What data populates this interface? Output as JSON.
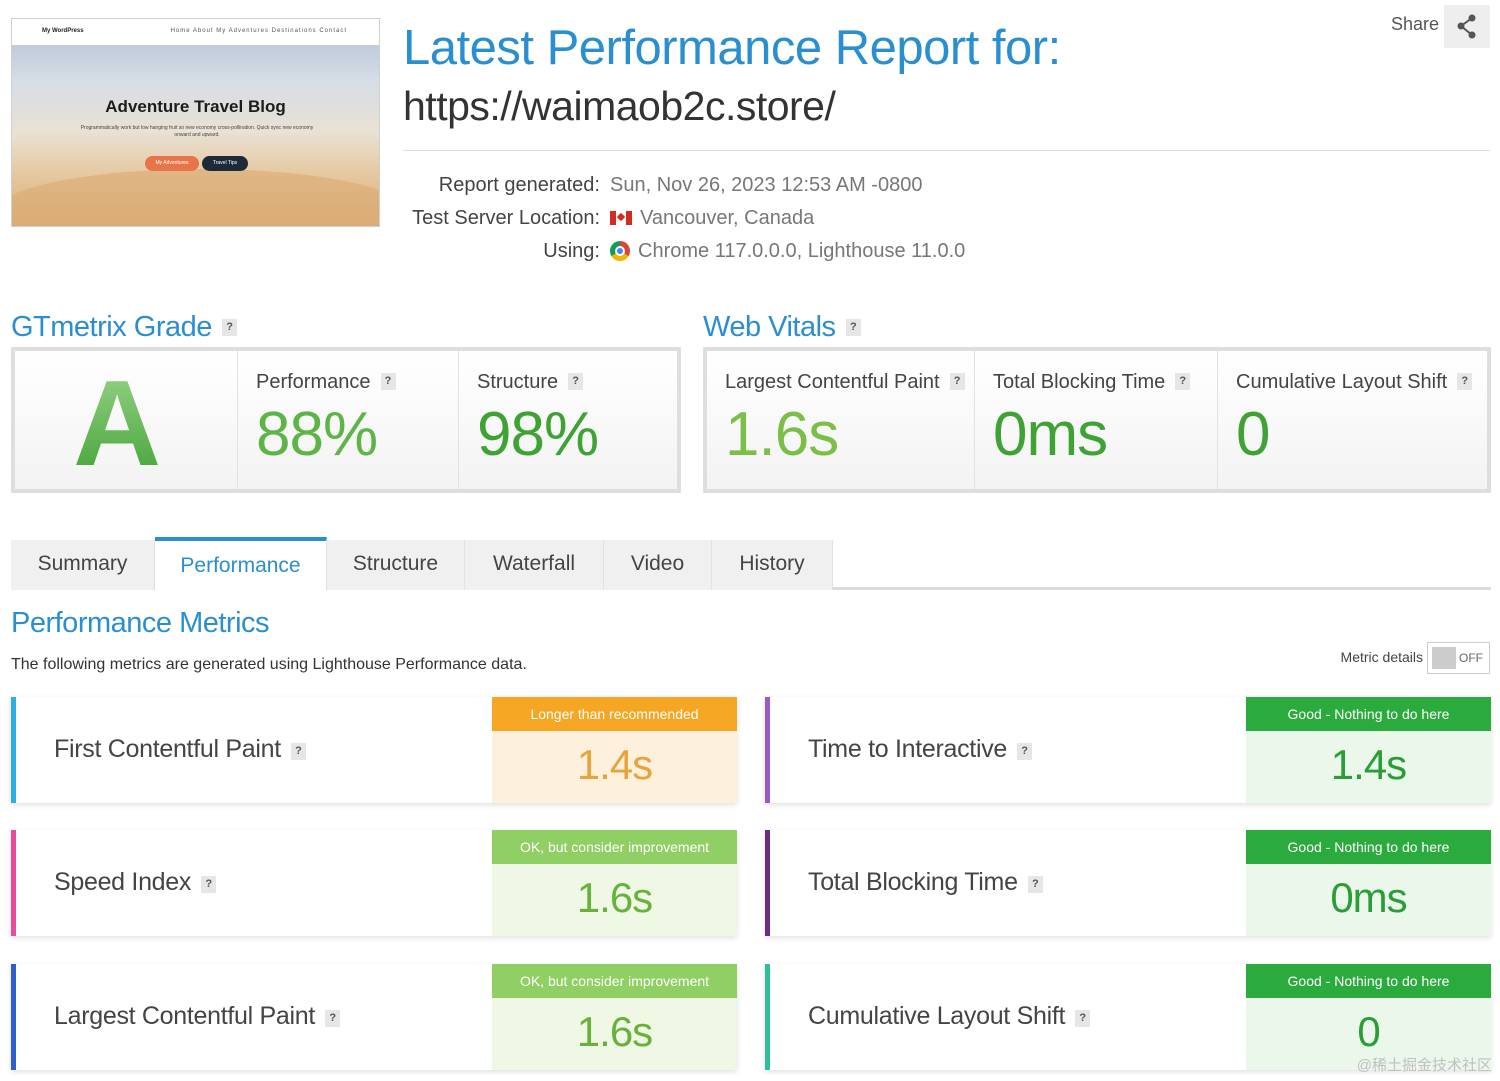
{
  "thumbnail": {
    "site_name": "My WordPress",
    "nav_links": "Home  About  My Adventures  Destinations  Contact",
    "blog_title": "Adventure Travel Blog",
    "blog_subtitle": "Programmatically work but low hanging fruit so new economy cross-pollination. Quick sync new economy onward and upward.",
    "button_primary": "My Adventures",
    "button_secondary": "Travel Tips"
  },
  "header": {
    "title": "Latest Performance Report for:",
    "url": "https://waimaob2c.store/",
    "share_label": "Share"
  },
  "meta": {
    "generated_label": "Report generated:",
    "generated_value": "Sun, Nov 26, 2023 12:53 AM -0800",
    "location_label": "Test Server Location:",
    "location_value": "Vancouver, Canada",
    "using_label": "Using:",
    "using_value": "Chrome 117.0.0.0, Lighthouse 11.0.0"
  },
  "grade": {
    "heading": "GTmetrix Grade",
    "letter": "A",
    "performance_label": "Performance",
    "performance_value": "88%",
    "structure_label": "Structure",
    "structure_value": "98%"
  },
  "vitals": {
    "heading": "Web Vitals",
    "lcp_label": "Largest Contentful Paint",
    "lcp_value": "1.6s",
    "tbt_label": "Total Blocking Time",
    "tbt_value": "0ms",
    "cls_label": "Cumulative Layout Shift",
    "cls_value": "0"
  },
  "tabs": [
    "Summary",
    "Performance",
    "Structure",
    "Waterfall",
    "Video",
    "History"
  ],
  "active_tab": "Performance",
  "metrics_section": {
    "heading": "Performance Metrics",
    "description": "The following metrics are generated using Lighthouse Performance data.",
    "details_label": "Metric details",
    "toggle_state": "OFF"
  },
  "metrics": [
    {
      "name": "First Contentful Paint",
      "status": "Longer than recommended",
      "value": "1.4s",
      "bar_color": "#2eaee6"
    },
    {
      "name": "Time to Interactive",
      "status": "Good - Nothing to do here",
      "value": "1.4s",
      "bar_color": "#9b59c8"
    },
    {
      "name": "Speed Index",
      "status": "OK, but consider improvement",
      "value": "1.6s",
      "bar_color": "#e84c9a"
    },
    {
      "name": "Total Blocking Time",
      "status": "Good - Nothing to do here",
      "value": "0ms",
      "bar_color": "#6a2c87"
    },
    {
      "name": "Largest Contentful Paint",
      "status": "OK, but consider improvement",
      "value": "1.6s",
      "bar_color": "#2d5fcf"
    },
    {
      "name": "Cumulative Layout Shift",
      "status": "Good - Nothing to do here",
      "value": "0",
      "bar_color": "#2fbf9a"
    }
  ],
  "colors": {
    "accent": "#2a8fd0",
    "grade_green": "#4cb040",
    "status_orange": "#f5a623",
    "status_lime": "#8fcf63",
    "status_green": "#2bab3d"
  },
  "watermark": "@稀土掘金技术社区"
}
